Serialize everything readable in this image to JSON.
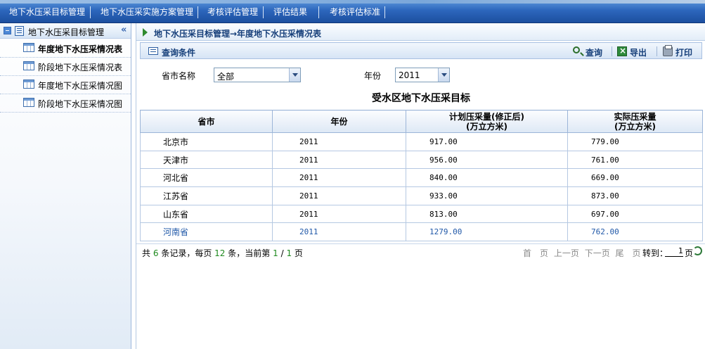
{
  "topnav": {
    "items": [
      "地下水压采目标管理",
      "地下水压采实施方案管理",
      "考核评估管理",
      "评估结果",
      "考核评估标准"
    ]
  },
  "sidebar": {
    "title": "地下水压采目标管理",
    "collapse_glyph": "«",
    "items": [
      {
        "label": "年度地下水压采情况表",
        "active": true
      },
      {
        "label": "阶段地下水压采情况表",
        "active": false
      },
      {
        "label": "年度地下水压采情况图",
        "active": false
      },
      {
        "label": "阶段地下水压采情况图",
        "active": false
      }
    ]
  },
  "breadcrumb": "地下水压采目标管理→年度地下水压采情况表",
  "querybar": {
    "title": "查询条件",
    "search_label": "查询",
    "export_label": "导出",
    "print_label": "打印"
  },
  "filters": {
    "province_label": "省市名称",
    "province_value": "全部",
    "year_label": "年份",
    "year_value": "2011"
  },
  "table": {
    "title": "受水区地下水压采目标",
    "headers": [
      "省市",
      "年份",
      "计划压采量(修正后)",
      "(万立方米)",
      "实际压采量",
      "(万立方米)"
    ],
    "rows": [
      [
        "北京市",
        "2011",
        "917.00",
        "779.00"
      ],
      [
        "天津市",
        "2011",
        "956.00",
        "761.00"
      ],
      [
        "河北省",
        "2011",
        "840.00",
        "669.00"
      ],
      [
        "江苏省",
        "2011",
        "933.00",
        "873.00"
      ],
      [
        "山东省",
        "2011",
        "813.00",
        "697.00"
      ],
      [
        "河南省",
        "2011",
        "1279.00",
        "762.00"
      ]
    ]
  },
  "pager": {
    "p1": "共",
    "total": "6",
    "p2": "条记录，每页",
    "per_page": "12",
    "p3": "条，当前第",
    "current": "1",
    "slash": "/",
    "pages": "1",
    "p4": "页",
    "first": "首　页",
    "prev": "上一页",
    "next": "下一页",
    "last": "尾　页",
    "goto_label": "转到：",
    "goto_value": "1",
    "goto_suffix": "页"
  },
  "colors": {
    "nav_blue": "#2d67bd",
    "breadcrumb_text": "#163f7a",
    "highlight_row": "#2058a8",
    "pager_number": "#1f8a1f"
  }
}
